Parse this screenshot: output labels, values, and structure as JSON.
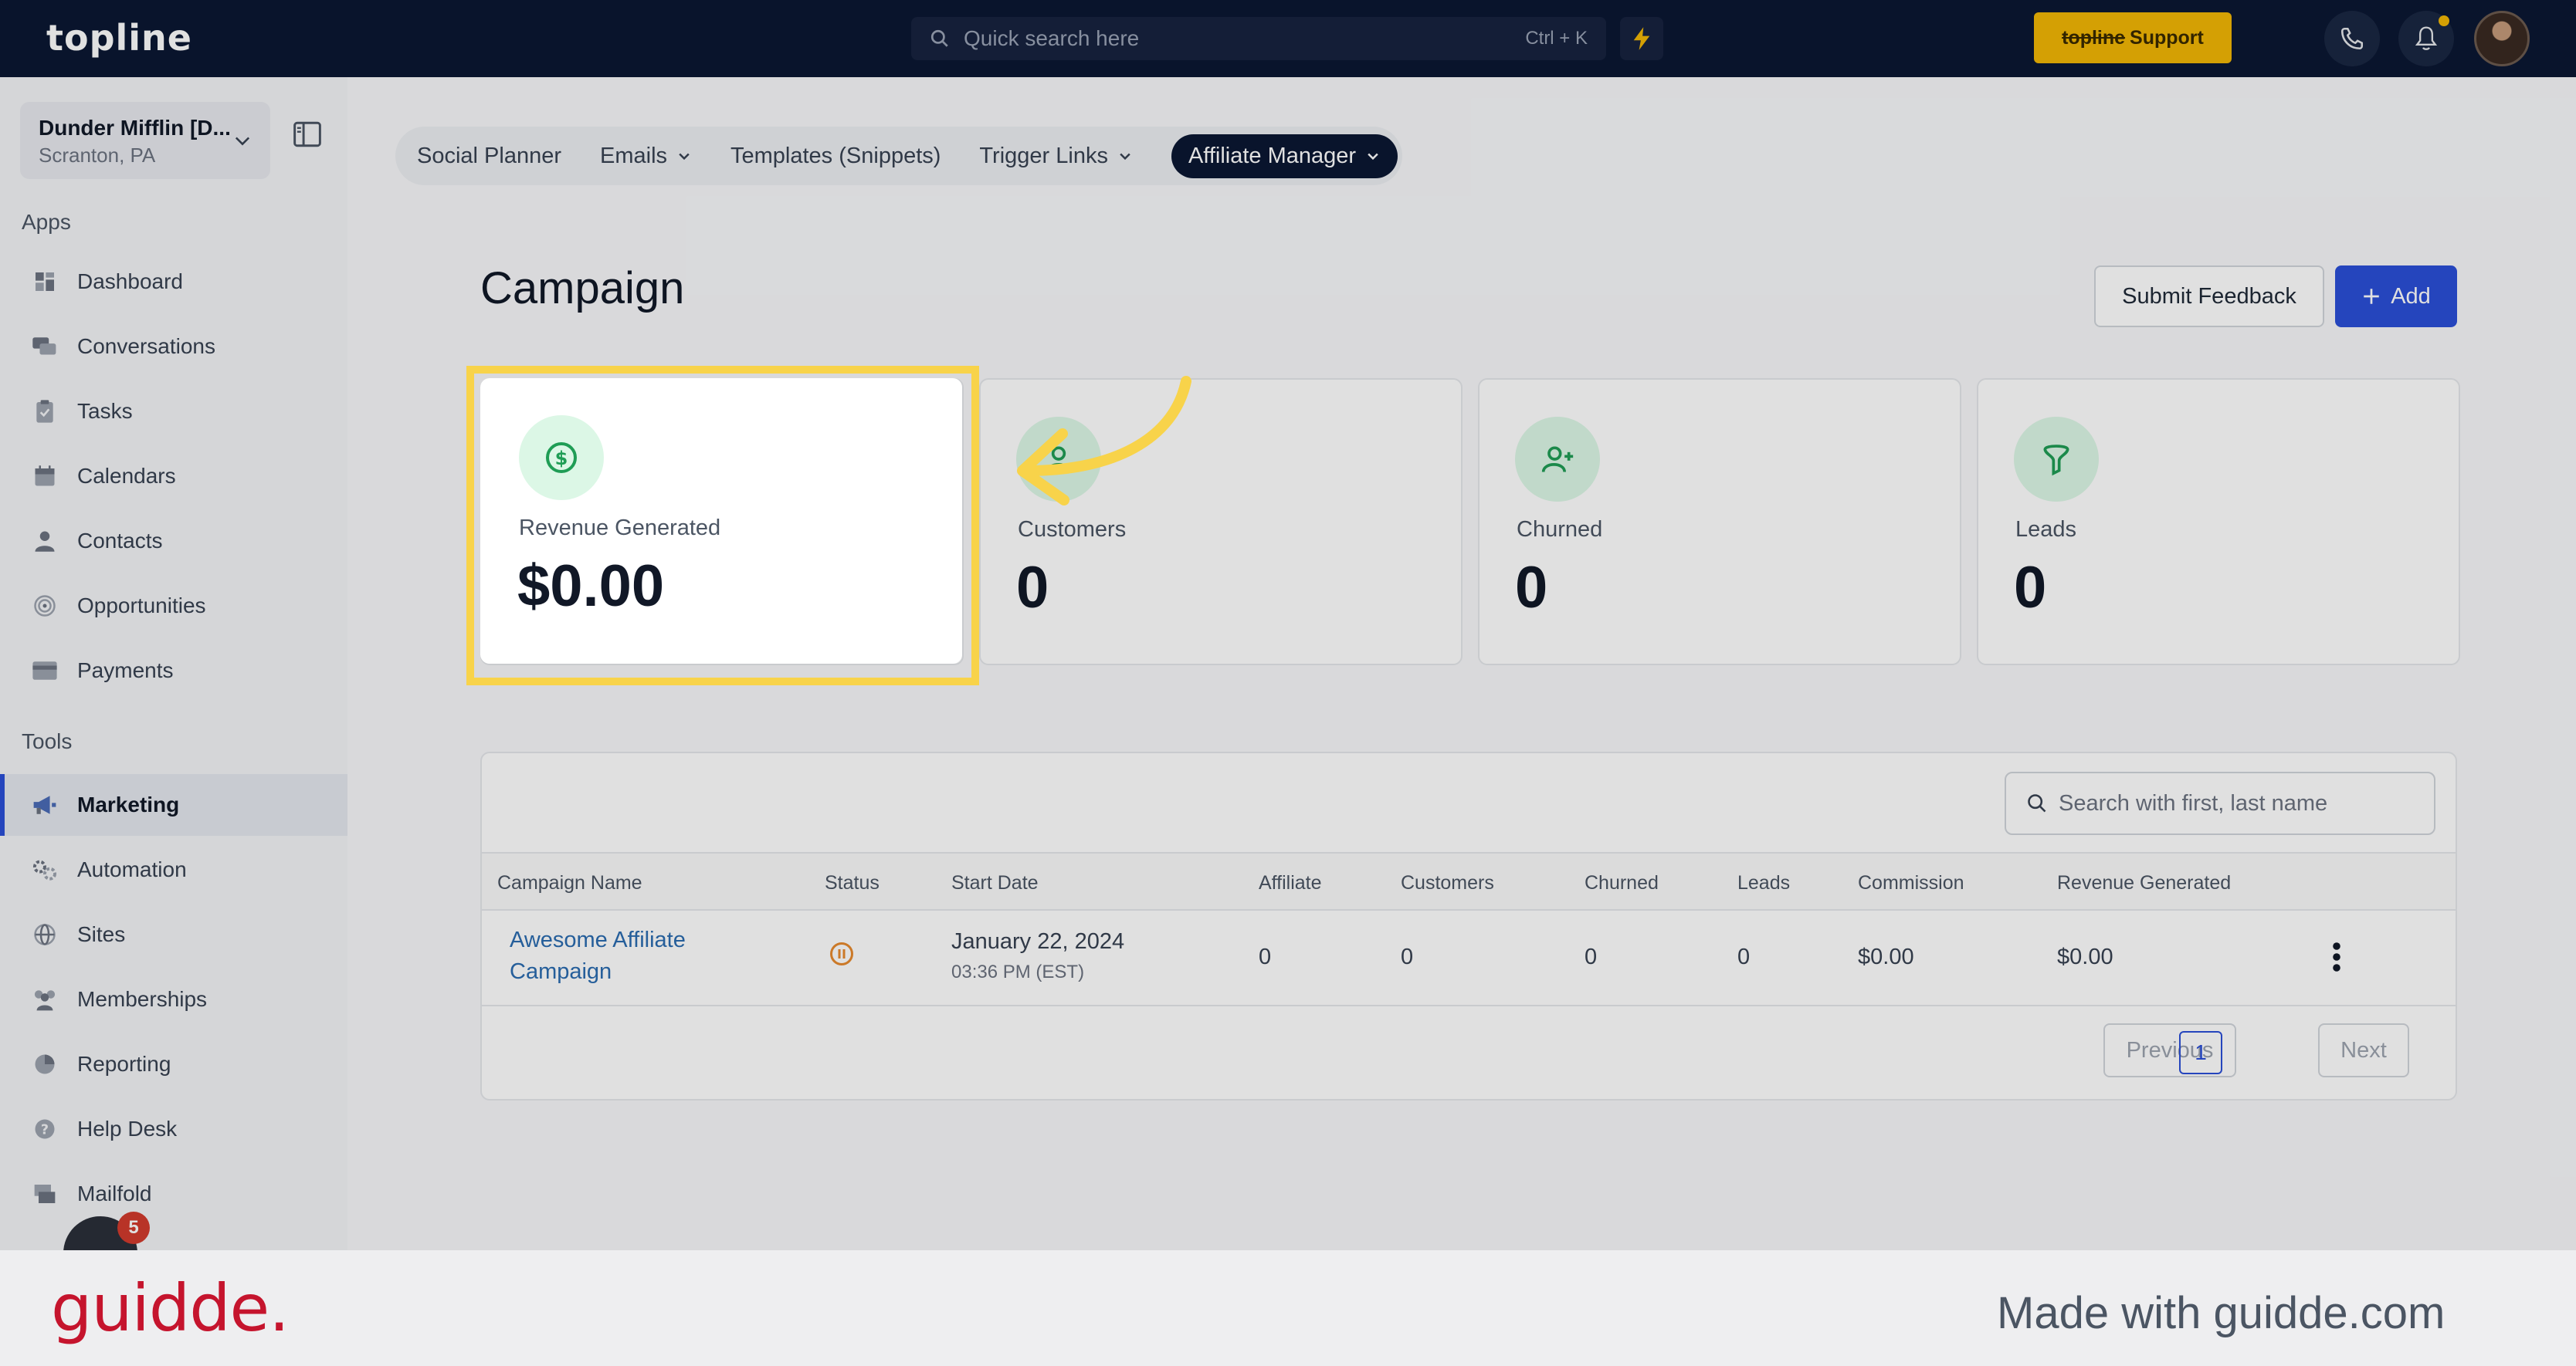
{
  "app": {
    "logo": "topline",
    "search_placeholder": "Quick search here",
    "search_shortcut": "Ctrl + K",
    "support_brand": "topline",
    "support_label": "Support"
  },
  "account": {
    "name": "Dunder Mifflin [D...",
    "location": "Scranton, PA"
  },
  "sidebar": {
    "apps_header": "Apps",
    "apps": [
      {
        "label": "Dashboard",
        "icon": "dashboard-icon"
      },
      {
        "label": "Conversations",
        "icon": "chat-icon"
      },
      {
        "label": "Tasks",
        "icon": "clipboard-icon"
      },
      {
        "label": "Calendars",
        "icon": "calendar-icon"
      },
      {
        "label": "Contacts",
        "icon": "user-icon"
      },
      {
        "label": "Opportunities",
        "icon": "target-icon"
      },
      {
        "label": "Payments",
        "icon": "credit-card-icon"
      }
    ],
    "tools_header": "Tools",
    "tools": [
      {
        "label": "Marketing",
        "icon": "megaphone-icon",
        "active": true
      },
      {
        "label": "Automation",
        "icon": "gears-icon"
      },
      {
        "label": "Sites",
        "icon": "globe-icon"
      },
      {
        "label": "Memberships",
        "icon": "users-icon"
      },
      {
        "label": "Reporting",
        "icon": "pie-chart-icon"
      },
      {
        "label": "Help Desk",
        "icon": "question-icon"
      },
      {
        "label": "Mailfold",
        "icon": "mail-stack-icon"
      }
    ],
    "chat_badge": "5"
  },
  "tabs": [
    {
      "label": "Social Planner",
      "dropdown": false
    },
    {
      "label": "Emails",
      "dropdown": true
    },
    {
      "label": "Templates (Snippets)",
      "dropdown": false
    },
    {
      "label": "Trigger Links",
      "dropdown": true
    },
    {
      "label": "Affiliate Manager",
      "dropdown": true,
      "active": true
    }
  ],
  "page": {
    "title": "Campaign",
    "submit_feedback": "Submit Feedback",
    "add": "Add"
  },
  "stats": [
    {
      "label": "Revenue Generated",
      "value": "$0.00",
      "icon": "dollar-circle-icon"
    },
    {
      "label": "Customers",
      "value": "0",
      "icon": "user-icon"
    },
    {
      "label": "Churned",
      "value": "0",
      "icon": "user-plus-icon"
    },
    {
      "label": "Leads",
      "value": "0",
      "icon": "funnel-icon"
    }
  ],
  "table": {
    "search_placeholder": "Search with first, last name",
    "columns": [
      "Campaign Name",
      "Status",
      "Start Date",
      "Affiliate",
      "Customers",
      "Churned",
      "Leads",
      "Commission",
      "Revenue Generated"
    ],
    "rows": [
      {
        "name_line1": "Awesome Affiliate",
        "name_line2": "Campaign",
        "status_icon": "pause-circle-icon",
        "start_date": "January 22, 2024",
        "start_time": "03:36 PM (EST)",
        "affiliate": "0",
        "customers": "0",
        "churned": "0",
        "leads": "0",
        "commission": "$0.00",
        "revenue": "$0.00"
      }
    ],
    "pagination": {
      "previous": "Previous",
      "page": "1",
      "next": "Next"
    }
  },
  "footer": {
    "brand": "guidde.",
    "made_with": "Made with guidde.com"
  },
  "colors": {
    "topbar": "#0b1733",
    "accent": "#2b4fd8",
    "support": "#f2b705",
    "highlight": "#f8d34a",
    "stat_icon_bg": "#dcf7e6",
    "stat_icon": "#1f9d55",
    "guidde": "#c5142d"
  }
}
